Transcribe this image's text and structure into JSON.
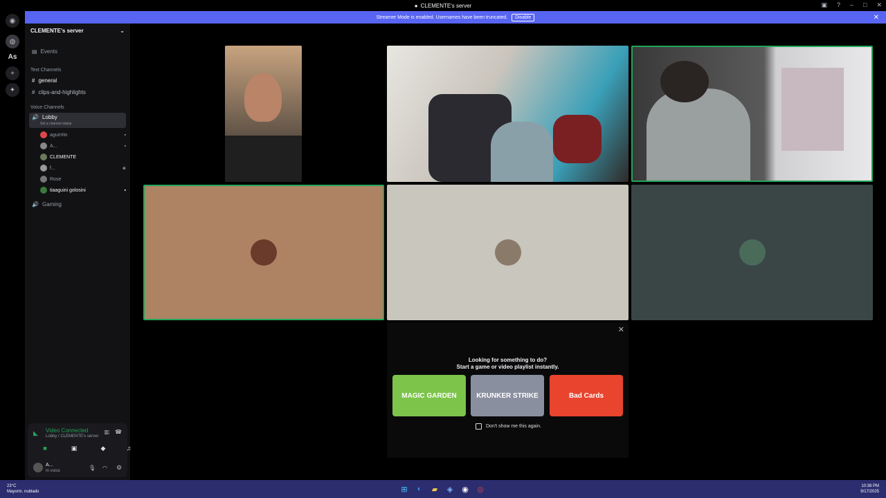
{
  "window": {
    "title": "CLEMENTE's server"
  },
  "banner": {
    "text": "Streamer Mode is enabled. Usernames have been truncated.",
    "disable_label": "Disable"
  },
  "rail": {
    "items": [
      {
        "icon": "discord-icon"
      },
      {
        "icon": "server-icon"
      },
      {
        "label": "As"
      },
      {
        "icon": "add-server-icon"
      },
      {
        "icon": "discover-icon"
      }
    ]
  },
  "sidebar": {
    "server_name": "CLEMENTE's server",
    "events_label": "Events",
    "text_category": "Text Channels",
    "text_channels": [
      "general",
      "clips-and-highlights"
    ],
    "voice_category": "Voice Channels",
    "lobby": {
      "name": "Lobby",
      "status": "Set a channel status"
    },
    "voice_users": [
      {
        "name": "aguirrito",
        "color": "#e0464b"
      },
      {
        "name": "A...",
        "color": "#888888"
      },
      {
        "name": "CLEMENTE",
        "color": "#6a7a5a"
      },
      {
        "name": "f...",
        "color": "#999999"
      },
      {
        "name": "Rose",
        "color": "#777777"
      },
      {
        "name": "tiaaguini golosini",
        "color": "#3a7a3a"
      }
    ],
    "gaming_channel": "Gaming"
  },
  "voice_panel": {
    "title": "Video Connected",
    "subtitle": "Lobby / CLEMENTE's server",
    "user_name": "A...",
    "user_status": "In voice"
  },
  "prompt": {
    "line1": "Looking for something to do?",
    "line2": "Start a game or video playlist instantly.",
    "games": [
      {
        "name": "MAGIC GARDEN",
        "bg": "#7cc44a"
      },
      {
        "name": "KRUNKER STRIKE",
        "bg": "#8a8fa0"
      },
      {
        "name": "Bad Cards",
        "bg": "#e8442e"
      }
    ],
    "checkbox_label": "Don't show me this again."
  },
  "taskbar": {
    "weather": "23°C",
    "weather_desc": "Mayorm. nublado",
    "time": "10:38 PM",
    "date": "9/17/2025"
  },
  "colors": {
    "accent": "#5865f2",
    "speaking": "#23a55a"
  }
}
